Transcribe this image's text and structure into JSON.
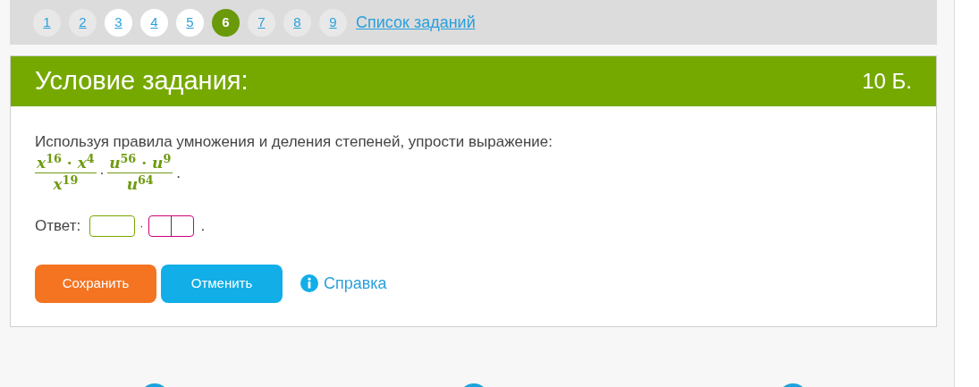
{
  "pagination": [
    {
      "label": "1",
      "selected": false,
      "highlighted": false
    },
    {
      "label": "2",
      "selected": false,
      "highlighted": false
    },
    {
      "label": "3",
      "selected": false,
      "highlighted": true
    },
    {
      "label": "4",
      "selected": false,
      "highlighted": true
    },
    {
      "label": "5",
      "selected": false,
      "highlighted": true
    },
    {
      "label": "6",
      "selected": true,
      "highlighted": false
    },
    {
      "label": "7",
      "selected": false,
      "highlighted": false
    },
    {
      "label": "8",
      "selected": false,
      "highlighted": false
    },
    {
      "label": "9",
      "selected": false,
      "highlighted": false
    }
  ],
  "task_list_link": "Список заданий",
  "task": {
    "title": "Условие задания:",
    "points": "10 Б.",
    "instruction": "Используя правила умножения и деления степеней, упрости выражение:",
    "expression": {
      "fractions": [
        {
          "numerator": "*x*$^{16}$ · *x*$^{4}$",
          "denominator": "*x*$^{19}$"
        },
        {
          "numerator": "*u*$^{56}$ · *u*$^{9}$",
          "denominator": "*u*$^{64}$"
        }
      ],
      "operator": "·",
      "end": "."
    },
    "answer": {
      "label": "Ответ:",
      "fields": [
        {
          "kind": "single",
          "color": "#76a900"
        },
        {
          "kind": "split",
          "color": "#cc0077"
        }
      ],
      "operator": "·",
      "end": "."
    },
    "buttons": [
      {
        "label": "Сохранить",
        "kind": "primary"
      },
      {
        "label": "Отменить",
        "kind": "secondary"
      }
    ],
    "help_link": "Справка"
  }
}
